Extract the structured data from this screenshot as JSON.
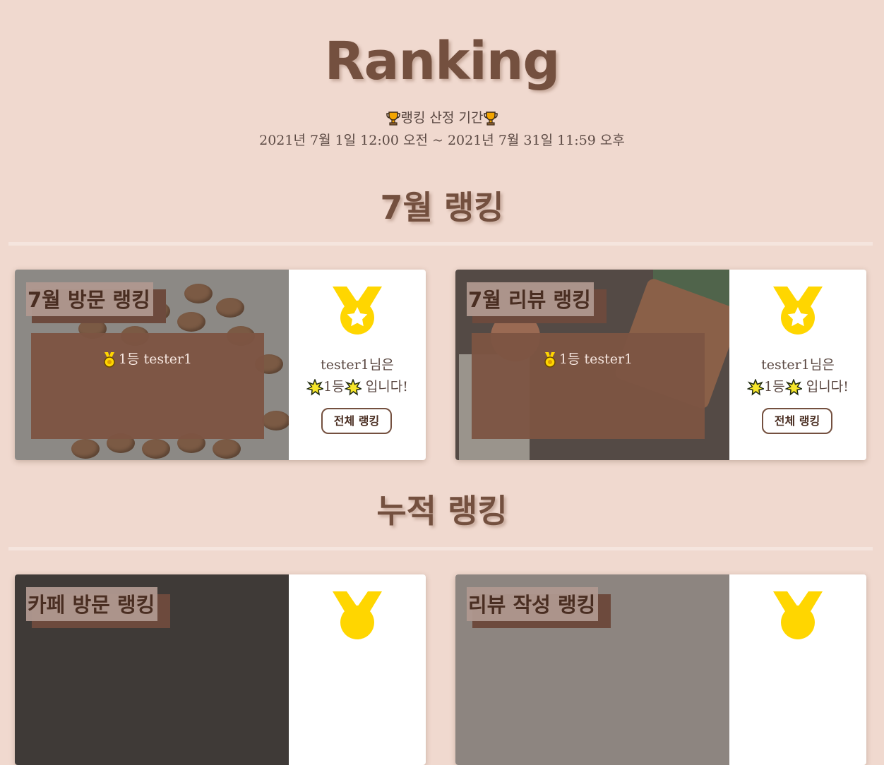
{
  "header": {
    "title": "Ranking",
    "period_label": "랭킹 산정 기간",
    "period_range": "2021년 7월 1일 12:00 오전 ~ 2021년 7월 31일 11:59 오후",
    "trophy_icon": "trophy-icon"
  },
  "colors": {
    "background": "#f0d9cf",
    "brand_brown": "#74503f",
    "medal_gold": "#ffd600"
  },
  "monthly": {
    "title": "7월 랭킹",
    "cards": [
      {
        "title": "7월 방문 랭킹",
        "rank_text": "1등 tester1",
        "message_line1": "tester1님은",
        "message_rank": "1등",
        "message_suffix": " 입니다!",
        "button_label": "전체 랭킹"
      },
      {
        "title": "7월 리뷰 랭킹",
        "rank_text": "1등 tester1",
        "message_line1": "tester1님은",
        "message_rank": "1등",
        "message_suffix": " 입니다!",
        "button_label": "전체 랭킹"
      }
    ]
  },
  "cumulative": {
    "title": "누적 랭킹",
    "cards": [
      {
        "title": "카페 방문 랭킹"
      },
      {
        "title": "리뷰 작성 랭킹"
      }
    ]
  }
}
